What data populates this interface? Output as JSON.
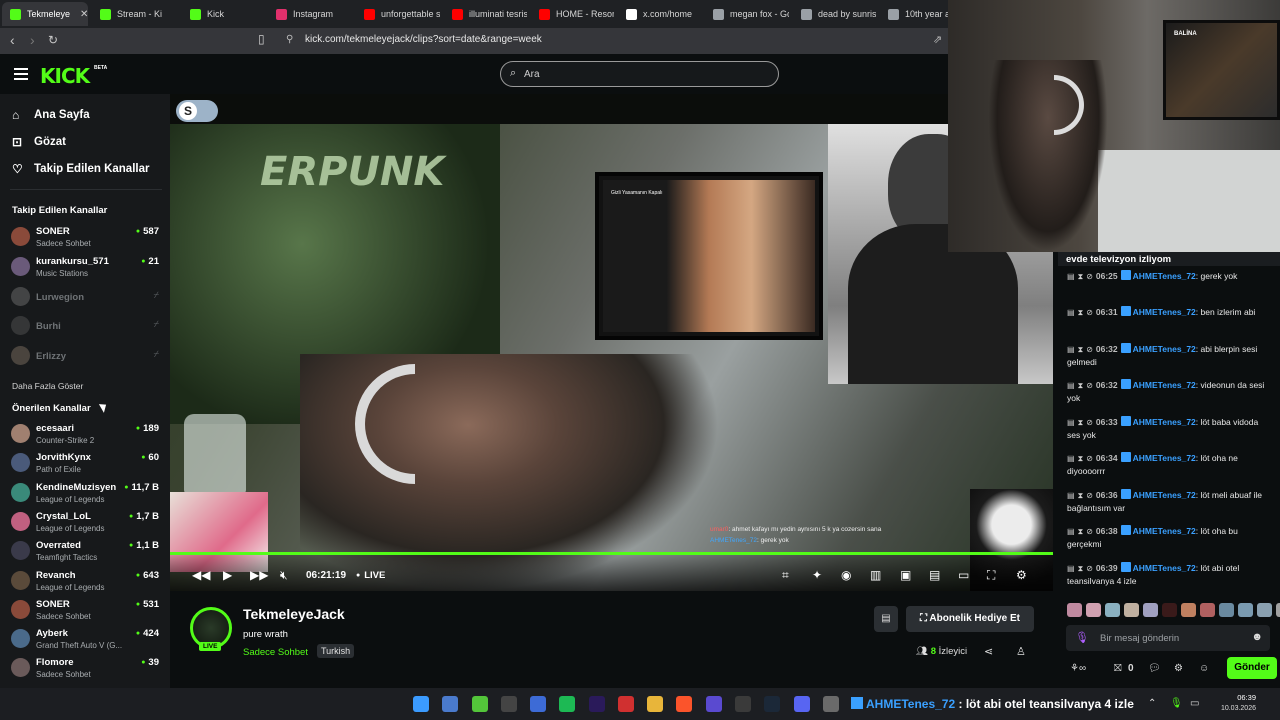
{
  "browser": {
    "tabs": [
      {
        "label": "Tekmeleye",
        "color": "#53fc18",
        "active": true
      },
      {
        "label": "Stream - Ki",
        "color": "#53fc18"
      },
      {
        "label": "Kick",
        "color": "#53fc18"
      },
      {
        "label": "Instagram",
        "color": "#e1306c"
      },
      {
        "label": "unforgettable s",
        "color": "#ff0000"
      },
      {
        "label": "illuminati tesris",
        "color": "#ff0000"
      },
      {
        "label": "HOME - Reson",
        "color": "#ff0000"
      },
      {
        "label": "x.com/home",
        "color": "#ffffff"
      },
      {
        "label": "megan fox - Go",
        "color": "#9aa0a6"
      },
      {
        "label": "dead by sunris",
        "color": "#9aa0a6"
      },
      {
        "label": "10th year ann",
        "color": "#9aa0a6"
      }
    ],
    "url": "kick.com/tekmeleyejack/clips?sort=date&range=week"
  },
  "header": {
    "logo": "KICK",
    "logo_badge": "BETA",
    "search_placeholder": "Ara"
  },
  "sidebar": {
    "nav": [
      {
        "label": "Ana Sayfa",
        "icon": "home-icon"
      },
      {
        "label": "Gözat",
        "icon": "browse-icon"
      },
      {
        "label": "Takip Edilen Kanallar",
        "icon": "heart-icon"
      }
    ],
    "followed_title": "Takip Edilen Kanallar",
    "followed": [
      {
        "name": "SONER",
        "category": "Sadece Sohbet",
        "viewers": "587",
        "color": "#8a4a3a"
      },
      {
        "name": "kurankursu_571",
        "category": "Music Stations",
        "viewers": "21",
        "color": "#6a5a7a"
      }
    ],
    "offline": [
      {
        "name": "Lurwegion",
        "color": "#7a7a7a"
      },
      {
        "name": "Burhi",
        "color": "#5a5a5a"
      },
      {
        "name": "Erlizzy",
        "color": "#8a7a6a"
      }
    ],
    "show_more": "Daha Fazla Göster",
    "recommended_title": "Önerilen Kanallar",
    "recommended": [
      {
        "name": "ecesaari",
        "category": "Counter-Strike 2",
        "viewers": "189",
        "color": "#a08070"
      },
      {
        "name": "JorvithKynx",
        "category": "Path of Exile",
        "viewers": "60",
        "color": "#4a5a7a"
      },
      {
        "name": "KendineMuzisyen",
        "category": "League of Legends",
        "viewers": "11,7 B",
        "color": "#3a8a7a"
      },
      {
        "name": "Crystal_LoL",
        "category": "League of Legends",
        "viewers": "1,7 B",
        "color": "#c06080"
      },
      {
        "name": "Overrated",
        "category": "Teamfight Tactics",
        "viewers": "1,1 B",
        "color": "#3a3a4a"
      },
      {
        "name": "Revanch",
        "category": "League of Legends",
        "viewers": "643",
        "color": "#5a4a3a"
      },
      {
        "name": "SONER",
        "category": "Sadece Sohbet",
        "viewers": "531",
        "color": "#8a4a3a"
      },
      {
        "name": "Ayberk",
        "category": "Grand Theft Auto V (G...",
        "viewers": "424",
        "color": "#4a6a8a"
      },
      {
        "name": "Flomore",
        "category": "Sadece Sohbet",
        "viewers": "39",
        "color": "#6a5a5a"
      }
    ]
  },
  "video": {
    "poster_text": "ERPUNK",
    "tv_text": "Gizli Yasamanın Kapalı",
    "time": "06:21:19",
    "live": "LIVE",
    "overlay_chat": [
      {
        "user": "umar0",
        "text": ": ahmet kafayı mı yedin aynısını 5 k ya cozersin sana"
      },
      {
        "user": "AHMETenes_72",
        "text": ": gerek yok"
      }
    ]
  },
  "stream": {
    "name": "TekmeleyeJack",
    "title": "pure wrath",
    "category": "Sadece Sohbet",
    "language": "Turkish",
    "live_badge": "LIVE",
    "gift_button": "Abonelik Hediye Et",
    "viewers": "8",
    "viewers_label": "İzleyici"
  },
  "webcam": {
    "tv_label": "BALİNA"
  },
  "chat": {
    "pinned": "evde televizyon izliyom",
    "messages": [
      {
        "time": "06:25",
        "user": "AHMETenes_72",
        "text": ": gerek yok"
      },
      {
        "time": "06:31",
        "user": "AHMETenes_72",
        "text": ": ben izlerim abi"
      },
      {
        "time": "06:32",
        "user": "AHMETenes_72",
        "text": ": abi blerpin sesi gelmedi"
      },
      {
        "time": "06:32",
        "user": "AHMETenes_72",
        "text": ": videonun da sesi yok"
      },
      {
        "time": "06:33",
        "user": "AHMETenes_72",
        "text": ": löt baba vidoda ses yok"
      },
      {
        "time": "06:34",
        "user": "AHMETenes_72",
        "text": ": löt oha ne diyoooorrr"
      },
      {
        "time": "06:36",
        "user": "AHMETenes_72",
        "text": ": löt meli abuaf ile bağlantısım var"
      },
      {
        "time": "06:38",
        "user": "AHMETenes_72",
        "text": ": löt oha bu gerçekmi"
      },
      {
        "time": "06:39",
        "user": "AHMETenes_72",
        "text": ": löt abi otel teansilvanya 4 izle"
      }
    ],
    "emote_colors": [
      "#c08aa0",
      "#d0a0b0",
      "#8ab0c0",
      "#c0b0a0",
      "#a0a0c0",
      "#3a1a1a",
      "#c08060",
      "#b06060",
      "#6a8aa0",
      "#7a9ab0",
      "#8aa0b0",
      "#a0a0a0"
    ],
    "input_placeholder": "Bir mesaj gönderin",
    "points": "0",
    "send": "Gönder"
  },
  "taskbar": {
    "message_user": "AHMETenes_72",
    "message_text": " : löt abi otel teansilvanya 4 izle",
    "time": "06:39",
    "date": "10.03.2026"
  }
}
